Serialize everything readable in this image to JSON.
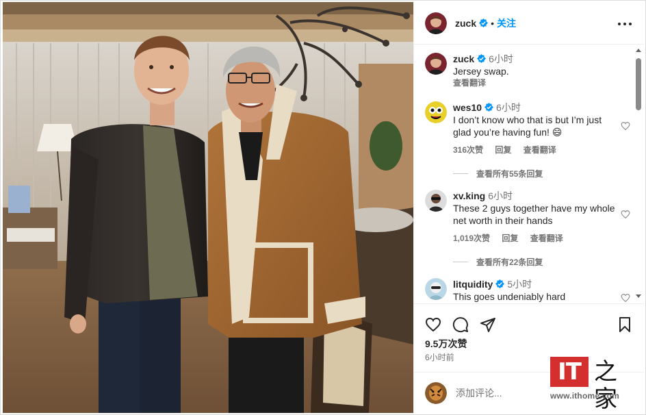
{
  "post": {
    "author": "zuck",
    "follow_label": "关注",
    "separator": "•",
    "more_icon": "more-horizontal-icon"
  },
  "caption": {
    "name": "zuck",
    "time": "6小时",
    "text": "Jersey swap.",
    "translate": "查看翻译"
  },
  "comments": [
    {
      "name": "wes10",
      "time": "6小时",
      "text": "I don’t know who that is but I’m just glad you’re having fun! 😄",
      "likes": "316次赞",
      "reply": "回复",
      "translate": "查看翻译",
      "view_replies": "查看所有55条回复"
    },
    {
      "name": "xv.king",
      "time": "6小时",
      "text": "These 2 guys together have my whole net worth in their hands",
      "likes": "1,019次赞",
      "reply": "回复",
      "translate": "查看翻译",
      "view_replies": "查看所有22条回复"
    },
    {
      "name": "litquidity",
      "time": "5小时",
      "text": "This goes undeniably hard"
    }
  ],
  "actions": {
    "like_icon": "heart-icon",
    "comment_icon": "comment-icon",
    "share_icon": "send-icon",
    "save_icon": "bookmark-icon",
    "likes_count": "9.5万次赞",
    "posted_time": "6小时前"
  },
  "add_comment": {
    "placeholder": "添加评论..."
  },
  "watermark": {
    "logo": "IT",
    "text": "之家",
    "url": "www.ithome.com"
  },
  "colors": {
    "accent": "#0095f6",
    "verified": "#0095f6",
    "muted": "#737373",
    "watermark_red": "#d32f2f"
  }
}
